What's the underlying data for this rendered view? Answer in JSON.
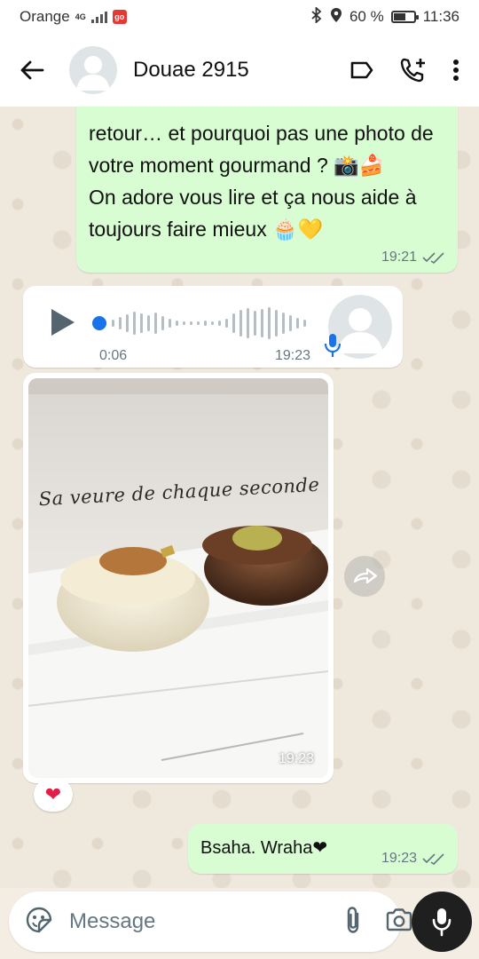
{
  "status_bar": {
    "carrier": "Orange",
    "network": "4G",
    "battery": "60 %",
    "battery_level": 0.6,
    "time": "11:36"
  },
  "header": {
    "contact_name": "Douae 2915",
    "icons": [
      "back-arrow-icon",
      "label-icon",
      "add-call-icon",
      "more-vertical-icon"
    ]
  },
  "messages": [
    {
      "type": "text",
      "direction": "outgoing",
      "text": "retour… et pourquoi pas une photo de votre moment gourmand ? 📸🍰\nOn adore vous lire et ça nous aide à toujours faire mieux 🧁💛",
      "time": "19:21",
      "status": "read"
    },
    {
      "type": "voice",
      "direction": "incoming",
      "duration": "0:06",
      "time": "19:23"
    },
    {
      "type": "image",
      "direction": "incoming",
      "caption_in_image": "Sa veure de chaque seconde",
      "time": "19:23",
      "reaction": "❤"
    },
    {
      "type": "text",
      "direction": "outgoing",
      "text": "Bsaha. Wraha❤",
      "time": "19:23",
      "status": "read"
    }
  ],
  "input": {
    "placeholder": "Message"
  },
  "colors": {
    "outgoing_bubble": "#d9fdd3",
    "incoming_bubble": "#ffffff",
    "read_ticks": "#667781",
    "mic_button": "#1f1f1f"
  }
}
